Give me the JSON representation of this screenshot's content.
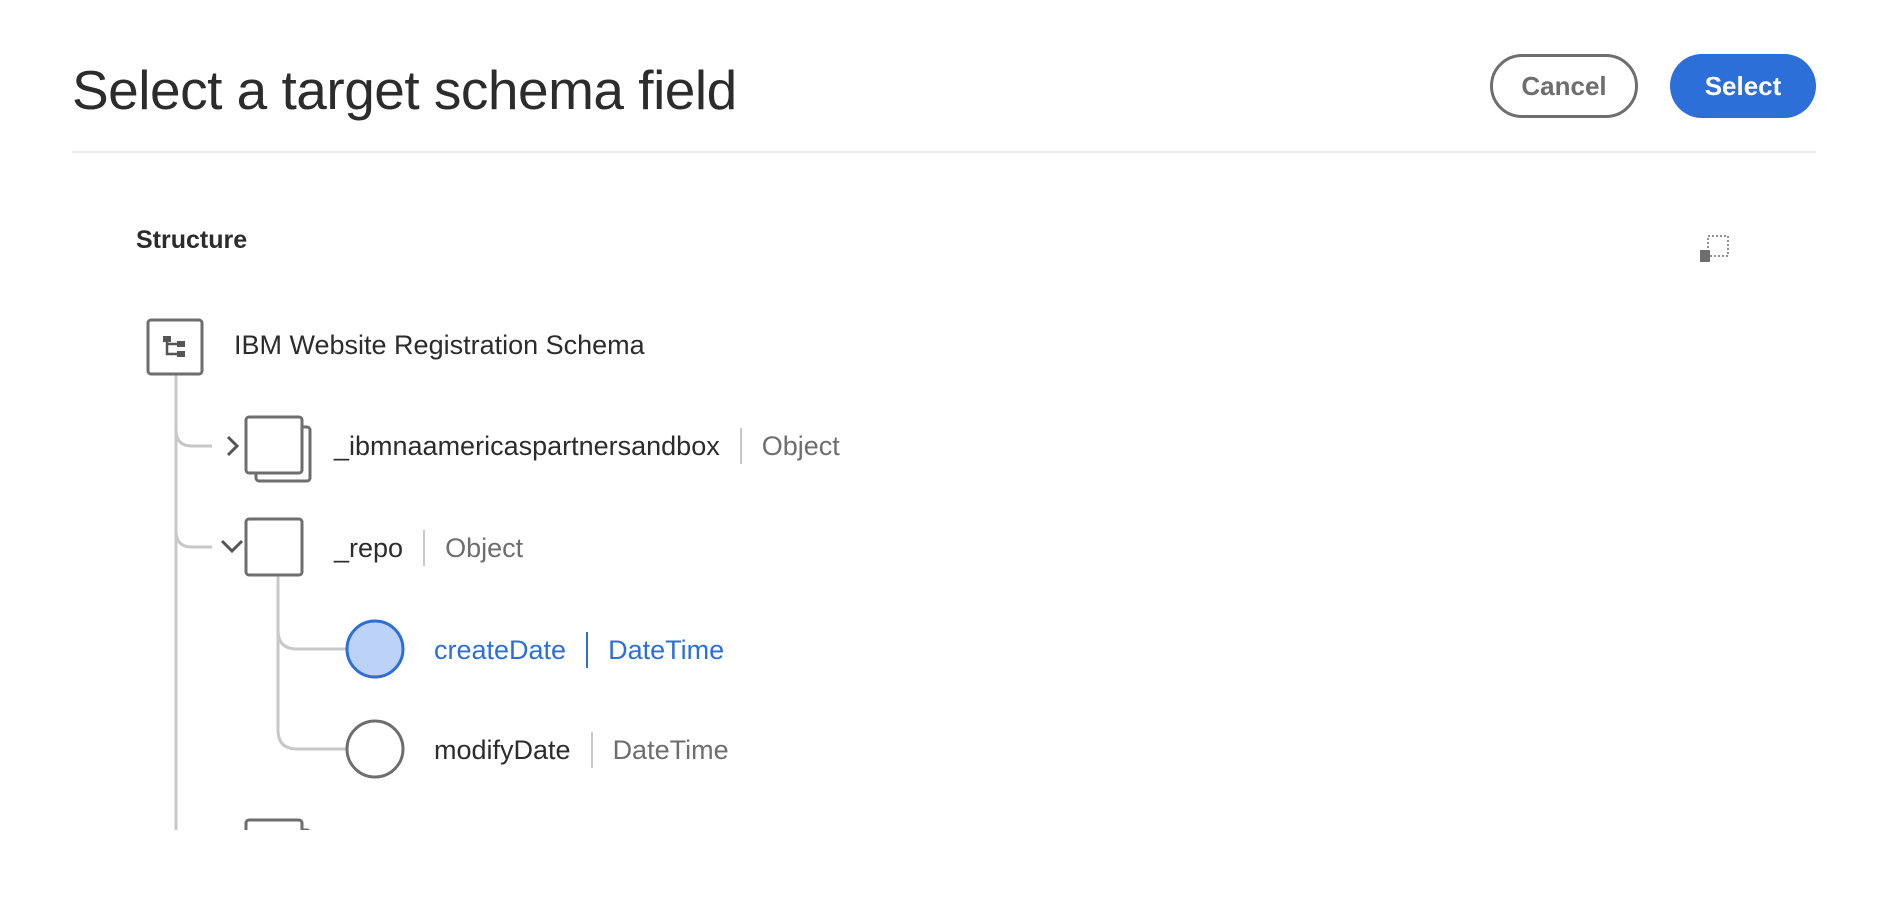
{
  "dialog": {
    "title": "Select a target schema field",
    "cancel_label": "Cancel",
    "select_label": "Select"
  },
  "structure": {
    "label": "Structure",
    "toggle_icon": "expand-collapse-icon"
  },
  "tree": {
    "root": {
      "name": "IBM Website Registration Schema",
      "icon": "schema-tree-icon"
    },
    "nodes": [
      {
        "name": "_ibmnaamericaspartnersandbox",
        "type": "Object",
        "expanded": false,
        "icon": "object-array-icon"
      },
      {
        "name": "_repo",
        "type": "Object",
        "expanded": true,
        "icon": "object-icon"
      },
      {
        "name": "createDate",
        "type": "DateTime",
        "selected": true,
        "icon": "field-circle-icon"
      },
      {
        "name": "modifyDate",
        "type": "DateTime",
        "selected": false,
        "icon": "field-circle-icon"
      }
    ]
  },
  "colors": {
    "accent": "#2d6fd9",
    "selected_fill": "#bcd3f7",
    "line": "#c8c8c8",
    "icon_stroke": "#6e6e6e"
  }
}
